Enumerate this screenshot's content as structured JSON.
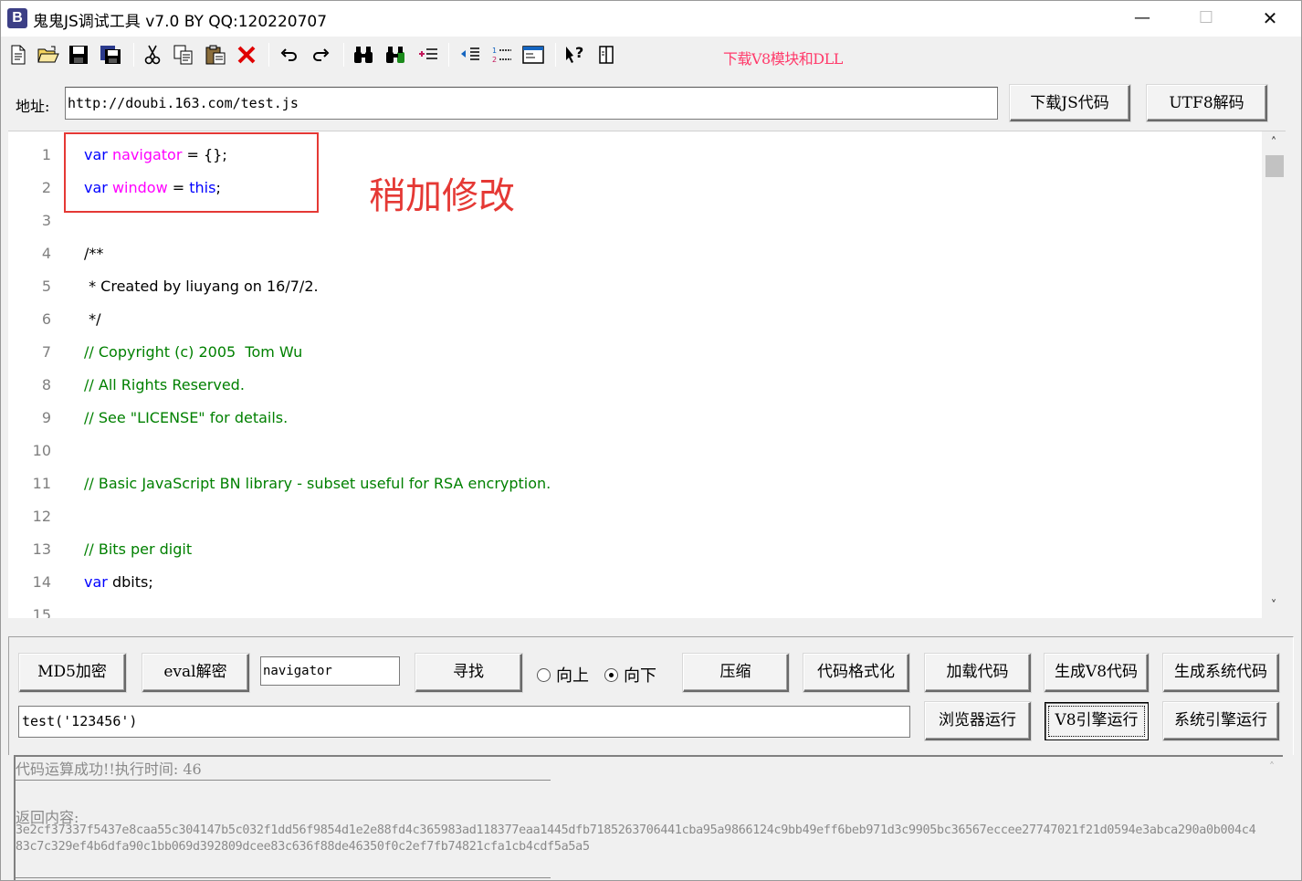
{
  "window": {
    "icon_letter": "B",
    "title": "鬼鬼JS调试工具 v7.0 BY QQ:120220707",
    "minimize": "—",
    "maximize": "☐",
    "close": "✕"
  },
  "toolbar": {
    "icons": [
      "new-file-icon",
      "open-folder-icon",
      "save-icon",
      "save-all-icon",
      "cut-icon",
      "copy-icon",
      "paste-icon",
      "delete-icon",
      "undo-icon",
      "redo-icon",
      "find-icon",
      "find-next-icon",
      "indent-list-icon",
      "outdent-icon",
      "numbered-list-icon",
      "window-icon",
      "help-icon",
      "panel-icon"
    ],
    "download_link": "下载V8模块和DLL"
  },
  "address": {
    "label": "地址:",
    "url": "http://doubi.163.com/test.js",
    "download_js_button": "下载JS代码",
    "utf8_decode_button": "UTF8解码"
  },
  "editor": {
    "line_numbers": [
      "1",
      "2",
      "3",
      "4",
      "5",
      "6",
      "7",
      "8",
      "9",
      "10",
      "11",
      "12",
      "13",
      "14",
      "15"
    ],
    "lines": {
      "l1_kw": "var",
      "l1_id": "navigator",
      "l1_rest": " = {};",
      "l2_kw": "var",
      "l2_id": "window",
      "l2_eq": " = ",
      "l2_this": "this",
      "l2_semi": ";",
      "l4": "/**",
      "l5": " * Created by liuyang on 16/7/2.",
      "l6": " */",
      "l7": "// Copyright (c) 2005  Tom Wu",
      "l8": "// All Rights Reserved.",
      "l9": "// See \"LICENSE\" for details.",
      "l11": "// Basic JavaScript BN library - subset useful for RSA encryption.",
      "l13": "// Bits per digit",
      "l14_kw": "var",
      "l14_rest": " dbits;"
    },
    "annotation": "稍加修改",
    "annotation_color": "#e53935"
  },
  "controls": {
    "md5_button": "MD5加密",
    "eval_button": "eval解密",
    "search_value": "navigator",
    "find_button": "寻找",
    "radio_up": "向上",
    "radio_down": "向下",
    "compress_button": "压缩",
    "format_button": "代码格式化",
    "load_button": "加载代码",
    "gen_v8_button": "生成V8代码",
    "gen_sys_button": "生成系统代码",
    "call_value": "test('123456')",
    "browser_run_button": "浏览器运行",
    "v8_run_button": "V8引擎运行",
    "sys_run_button": "系统引擎运行"
  },
  "output": {
    "status": "代码运算成功!!执行时间: 46",
    "result_label": "返回内容:",
    "result": "3e2cf37337f5437e8caa55c304147b5c032f1dd56f9854d1e2e88fd4c365983ad118377eaa1445dfb7185263706441cba95a9866124c9bb49eff6beb971d3c9905bc36567eccee27747021f21d0594e3abca290a0b004c483c7c329ef4b6dfa90c1bb069d392809dcee83c636f88de46350f0c2ef7fb74821cfa1cb4cdf5a5a5"
  },
  "colors": {
    "keyword": "#0000ff",
    "identifier": "#ff00ff",
    "comment": "#008000",
    "download_link": "#ff3b6b"
  }
}
